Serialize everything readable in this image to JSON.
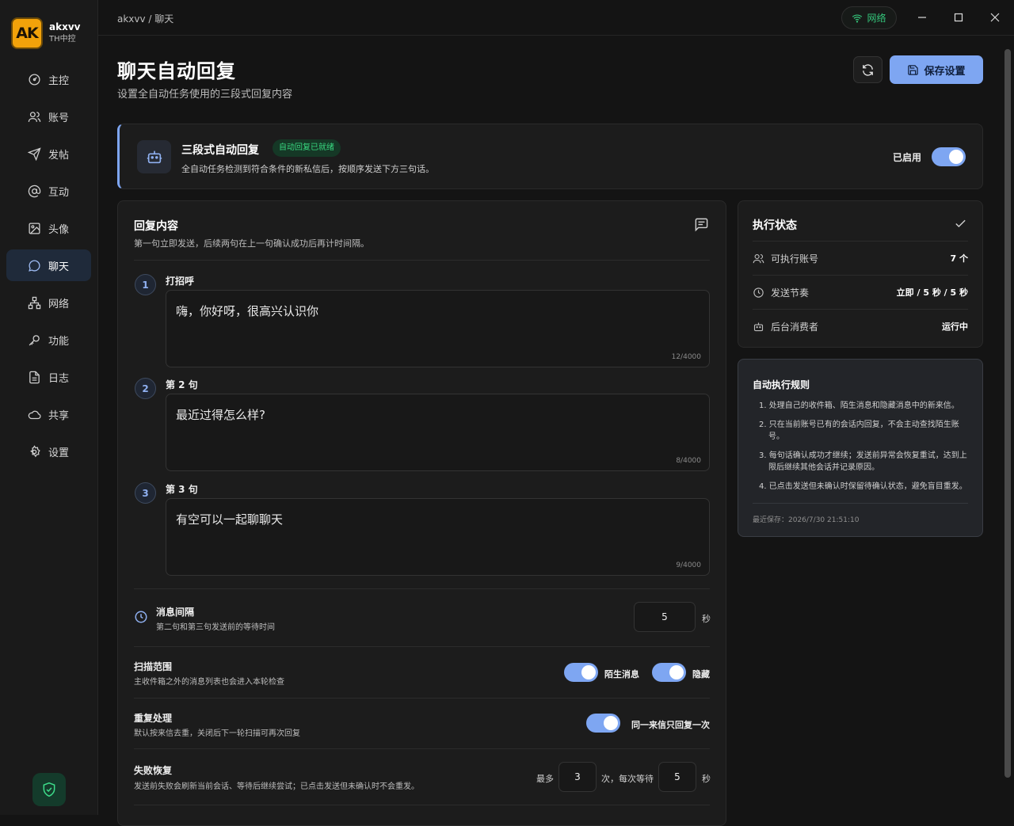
{
  "brand": {
    "logo": "AK",
    "name": "akxvv",
    "sub": "TH中控"
  },
  "nav": [
    {
      "label": "主控",
      "icon": "dashboard-icon"
    },
    {
      "label": "账号",
      "icon": "users-icon"
    },
    {
      "label": "发帖",
      "icon": "send-icon"
    },
    {
      "label": "互动",
      "icon": "at-icon"
    },
    {
      "label": "头像",
      "icon": "image-icon"
    },
    {
      "label": "聊天",
      "icon": "chat-icon",
      "active": true
    },
    {
      "label": "网络",
      "icon": "network-icon"
    },
    {
      "label": "功能",
      "icon": "key-icon"
    },
    {
      "label": "日志",
      "icon": "file-icon"
    },
    {
      "label": "共享",
      "icon": "cloud-icon"
    },
    {
      "label": "设置",
      "icon": "gear-icon"
    }
  ],
  "topbar": {
    "breadcrumb": "akxvv / 聊天",
    "network_label": "网络"
  },
  "header": {
    "title": "聊天自动回复",
    "subtitle": "设置全自动任务使用的三段式回复内容",
    "save_label": "保存设置"
  },
  "banner": {
    "title": "三段式自动回复",
    "badge": "自动回复已就绪",
    "subtitle": "全自动任务检测到符合条件的新私信后，按顺序发送下方三句话。",
    "enabled_label": "已启用"
  },
  "content": {
    "title": "回复内容",
    "subtitle": "第一句立即发送，后续两句在上一句确认成功后再计时间隔。",
    "steps": [
      {
        "num": "1",
        "label": "打招呼",
        "text": "嗨，你好呀，很高兴认识你",
        "count": "12/4000"
      },
      {
        "num": "2",
        "label": "第 2 句",
        "text": "最近过得怎么样?",
        "count": "8/4000"
      },
      {
        "num": "3",
        "label": "第 3 句",
        "text": "有空可以一起聊聊天",
        "count": "9/4000"
      }
    ],
    "interval": {
      "title": "消息间隔",
      "subtitle": "第二句和第三句发送前的等待时间",
      "value": "5",
      "unit": "秒"
    },
    "scan": {
      "title": "扫描范围",
      "subtitle": "主收件箱之外的消息列表也会进入本轮检查",
      "opt1": "陌生消息",
      "opt2": "隐藏"
    },
    "dup": {
      "title": "重复处理",
      "subtitle": "默认按来信去重，关闭后下一轮扫描可再次回复",
      "opt": "同一来信只回复一次"
    },
    "retry": {
      "title": "失败恢复",
      "subtitle": "发送前失败会刷新当前会话、等待后继续尝试；已点击发送但未确认时不会重发。",
      "prefix": "最多",
      "count": "3",
      "mid": "次，每次等待",
      "wait": "5",
      "unit": "秒"
    }
  },
  "status": {
    "title": "执行状态",
    "rows": [
      {
        "label": "可执行账号",
        "value": "7 个",
        "icon": "users-icon"
      },
      {
        "label": "发送节奏",
        "value": "立即 / 5 秒 / 5 秒",
        "icon": "clock-icon"
      },
      {
        "label": "后台消费者",
        "value": "运行中",
        "icon": "bot-icon"
      }
    ]
  },
  "rules": {
    "title": "自动执行规则",
    "items": [
      "1. 处理自己的收件箱、陌生消息和隐藏消息中的新来信。",
      "2. 只在当前账号已有的会话内回复，不会主动查找陌生账号。",
      "3. 每句话确认成功才继续；发送前异常会恢复重试，达到上限后继续其他会话并记录原因。",
      "4. 已点击发送但未确认时保留待确认状态，避免盲目重发。"
    ],
    "footer": "最近保存：2026/7/30 21:51:10"
  }
}
